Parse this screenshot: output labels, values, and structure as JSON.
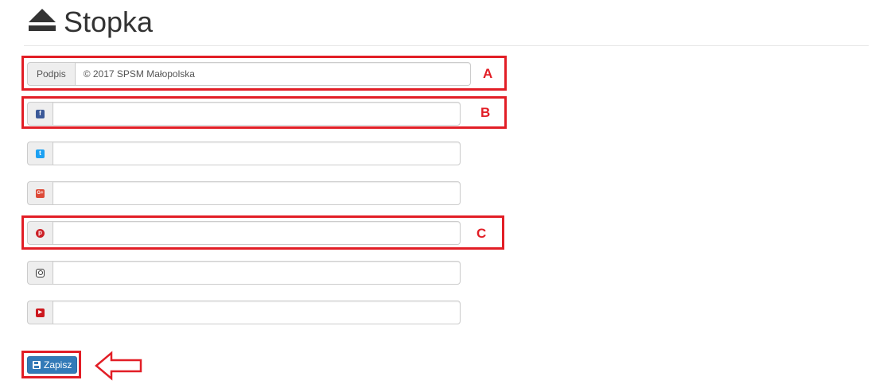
{
  "header": {
    "icon": "eject-icon",
    "title": "Stopka"
  },
  "fields": [
    {
      "id": "signature",
      "addon_label": "Podpis",
      "value": "© 2017 SPSM Małopolska",
      "placeholder": ""
    },
    {
      "id": "facebook",
      "icon": "facebook-icon",
      "glyph": "f",
      "value": "",
      "placeholder": ""
    },
    {
      "id": "twitter",
      "icon": "twitter-icon",
      "glyph": "t",
      "value": "",
      "placeholder": ""
    },
    {
      "id": "google-plus",
      "icon": "google-plus-icon",
      "glyph": "G+",
      "value": "",
      "placeholder": ""
    },
    {
      "id": "pinterest",
      "icon": "pinterest-icon",
      "glyph": "p",
      "value": "",
      "placeholder": ""
    },
    {
      "id": "instagram",
      "icon": "instagram-icon",
      "glyph": "",
      "value": "",
      "placeholder": ""
    },
    {
      "id": "youtube",
      "icon": "youtube-icon",
      "glyph": "▶",
      "value": "",
      "placeholder": ""
    }
  ],
  "annotations": {
    "a": "A",
    "b": "B",
    "c": "C"
  },
  "save_button": {
    "icon": "floppy-disk-icon",
    "label": "Zapisz"
  },
  "colors": {
    "annotation_red": "#e21e26",
    "button_blue": "#337ab7",
    "addon_bg": "#eeeeee",
    "border": "#cccccc"
  }
}
